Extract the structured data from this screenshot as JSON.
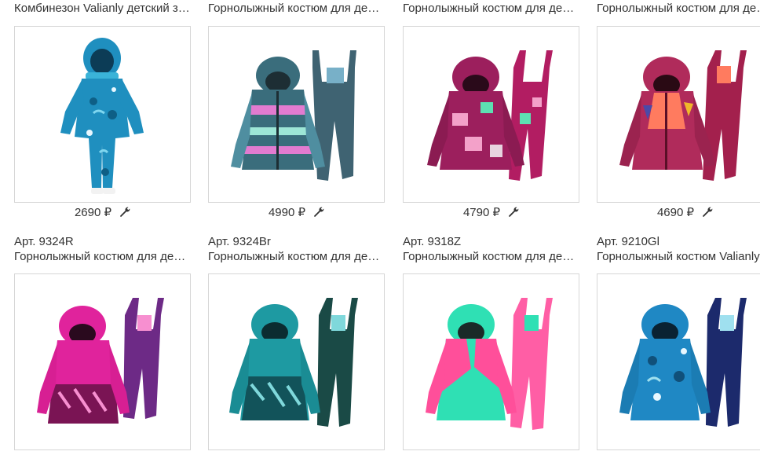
{
  "products": [
    {
      "article": "",
      "name": "Комбинезон Valianly детский зимний",
      "price": "2690 ₽",
      "colors": {
        "main": "#1f8fbf",
        "dark": "#0e5f86",
        "accent": "#7fd6ef",
        "pants": "#1f8fbf"
      }
    },
    {
      "article": "",
      "name": "Горнолыжный костюм для девочки",
      "price": "4990 ₽",
      "colors": {
        "main": "#3a6d7c",
        "dark": "#244b57",
        "accent": "#e27bd0",
        "pants": "#3f6372"
      }
    },
    {
      "article": "",
      "name": "Горнолыжный костюм для девочки",
      "price": "4790 ₽",
      "colors": {
        "main": "#9c1f5d",
        "dark": "#5d0f35",
        "accent": "#f3a1c9",
        "pants": "#b21d62"
      }
    },
    {
      "article": "",
      "name": "Горнолыжный костюм для девочки",
      "price": "4690 ₽",
      "colors": {
        "main": "#b02b5b",
        "dark": "#7a1a40",
        "accent": "#ff7b5f",
        "pants": "#a3204d"
      }
    },
    {
      "article": "Арт. 9324R",
      "name": "Горнолыжный костюм для девочки",
      "price": "",
      "colors": {
        "main": "#e0239c",
        "dark": "#7a1454",
        "accent": "#f78fd0",
        "pants": "#6d2a86"
      }
    },
    {
      "article": "Арт. 9324Br",
      "name": "Горнолыжный костюм для девочки",
      "price": "",
      "colors": {
        "main": "#1e9aa2",
        "dark": "#12535a",
        "accent": "#7fd8db",
        "pants": "#1a4a46"
      }
    },
    {
      "article": "Арт. 9318Z",
      "name": "Горнолыжный костюм для девочки",
      "price": "",
      "colors": {
        "main": "#2fe0b4",
        "dark": "#d8226b",
        "accent": "#ff4f9a",
        "pants": "#ff5ea5"
      }
    },
    {
      "article": "Арт. 9210Gl",
      "name": "Горнолыжный костюм Valianly детский",
      "price": "",
      "colors": {
        "main": "#1f88c4",
        "dark": "#10507a",
        "accent": "#9fe0ef",
        "pants": "#1c2a6c"
      }
    }
  ]
}
